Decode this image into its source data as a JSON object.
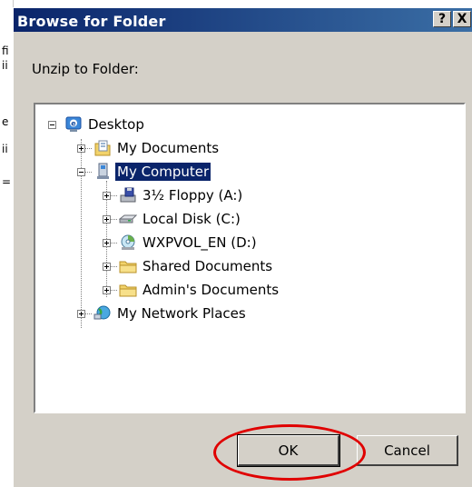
{
  "dialog": {
    "title": "Browse for Folder",
    "help_label": "?",
    "close_label": "X",
    "prompt": "Unzip to Folder:",
    "ok_label": "OK",
    "cancel_label": "Cancel"
  },
  "background_glyphs": [
    "fi",
    "ii",
    "e",
    "ii",
    "="
  ],
  "tree": {
    "items": [
      {
        "label": "Desktop",
        "icon": "desktop-icon",
        "level": 0,
        "expander": "minus"
      },
      {
        "label": "My Documents",
        "icon": "documents-folder-icon",
        "level": 1,
        "expander": "plus"
      },
      {
        "label": "My Computer",
        "icon": "computer-icon",
        "level": 1,
        "expander": "minus",
        "selected": true
      },
      {
        "label": "3½ Floppy (A:)",
        "icon": "floppy-drive-icon",
        "level": 2,
        "expander": "plus"
      },
      {
        "label": "Local Disk (C:)",
        "icon": "hard-disk-icon",
        "level": 2,
        "expander": "plus"
      },
      {
        "label": "WXPVOL_EN (D:)",
        "icon": "cd-drive-icon",
        "level": 2,
        "expander": "plus"
      },
      {
        "label": "Shared Documents",
        "icon": "folder-icon",
        "level": 2,
        "expander": "plus"
      },
      {
        "label": "Admin's Documents",
        "icon": "folder-icon",
        "level": 2,
        "expander": "plus"
      },
      {
        "label": "My Network Places",
        "icon": "network-places-icon",
        "level": 1,
        "expander": "plus"
      }
    ]
  },
  "colors": {
    "titlebar_start": "#0a246a",
    "titlebar_end": "#3a6ea5",
    "dialog_face": "#d4d0c8",
    "selection": "#0a246a",
    "annotation": "#e00000"
  }
}
